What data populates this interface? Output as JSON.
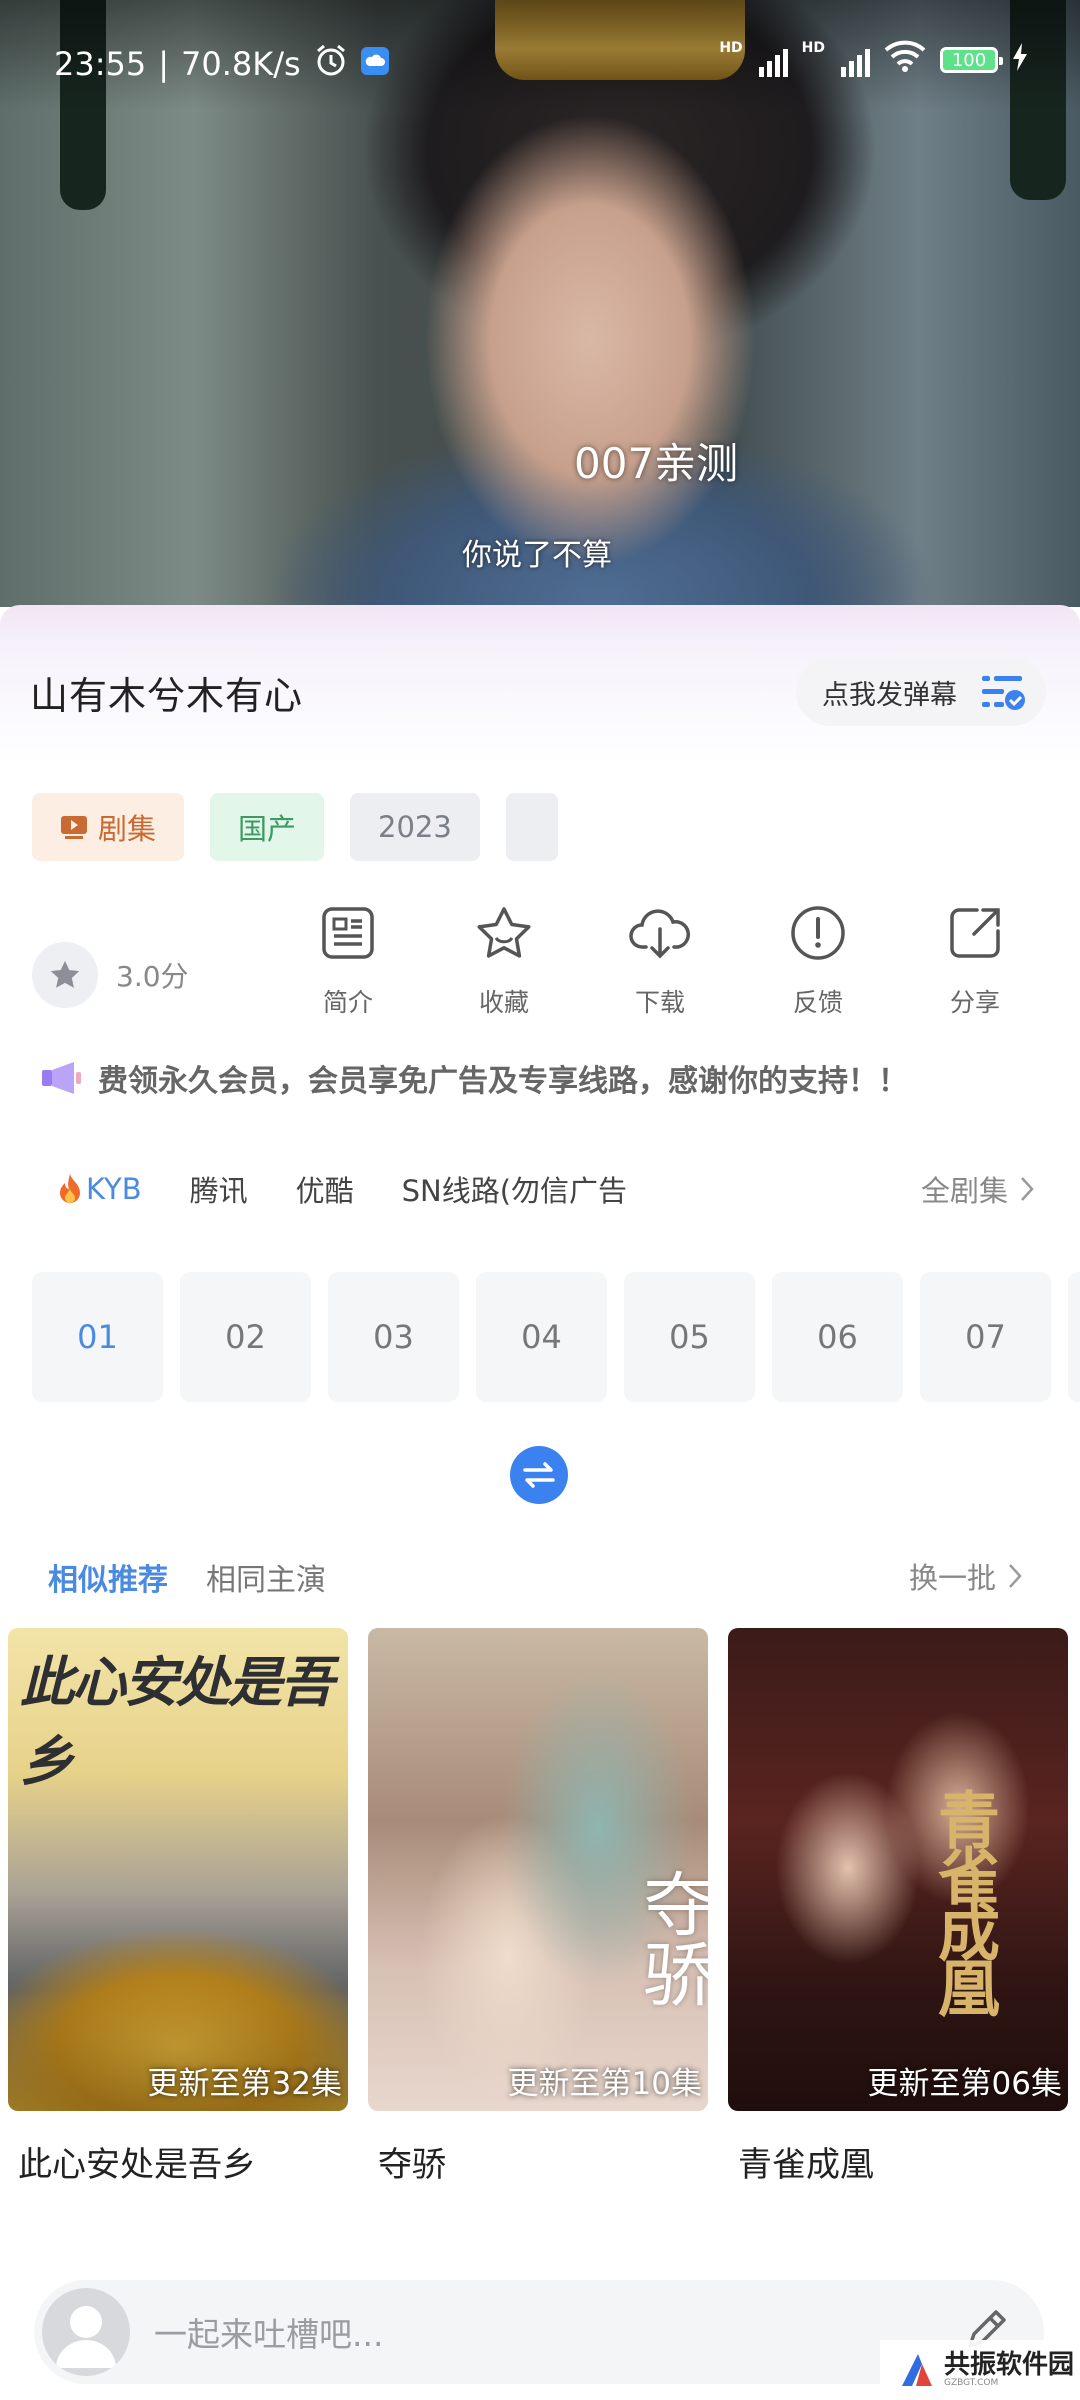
{
  "status_bar": {
    "time": "23:55",
    "speed": "70.8K/s",
    "battery": "100",
    "icons": [
      "alarm-icon",
      "cloud-icon",
      "signal-icon",
      "wifi-icon",
      "battery-icon",
      "charging-icon"
    ]
  },
  "video": {
    "subtitle_top": "007亲测",
    "subtitle_bottom": "你说了不算"
  },
  "show": {
    "title": "山有木兮木有心",
    "danmu_button": "点我发弹幕",
    "tags": [
      "剧集",
      "国产",
      "2023",
      ""
    ],
    "rating": "3.0分"
  },
  "actions": [
    {
      "label": "简介",
      "icon": "document-icon"
    },
    {
      "label": "收藏",
      "icon": "star-icon"
    },
    {
      "label": "下载",
      "icon": "cloud-download-icon"
    },
    {
      "label": "反馈",
      "icon": "alert-icon"
    },
    {
      "label": "分享",
      "icon": "share-icon"
    }
  ],
  "notice": "费领永久会员，会员享免广告及专享线路，感谢你的支持！！",
  "lines": {
    "items": [
      "KYB",
      "腾讯",
      "优酷",
      "SN线路(勿信广告"
    ],
    "all_episodes": "全剧集"
  },
  "episodes": [
    "01",
    "02",
    "03",
    "04",
    "05",
    "06",
    "07",
    ""
  ],
  "recommend": {
    "tab_similar": "相似推荐",
    "tab_cast": "相同主演",
    "refresh": "换一批",
    "cards": [
      {
        "title": "此心安处是吾乡",
        "update": "更新至第32集",
        "poster_text": "此心安处是吾乡"
      },
      {
        "title": "夺骄",
        "update": "更新至第10集",
        "poster_text": "夺骄"
      },
      {
        "title": "青雀成凰",
        "update": "更新至第06集",
        "poster_text": "青雀成凰"
      }
    ]
  },
  "comment": {
    "placeholder": "一起来吐槽吧..."
  },
  "watermark": {
    "text": "共振软件园",
    "sub": "GZBGT.COM"
  },
  "colors": {
    "accent": "#4a8ae0",
    "swap_button": "#3b82f0"
  }
}
